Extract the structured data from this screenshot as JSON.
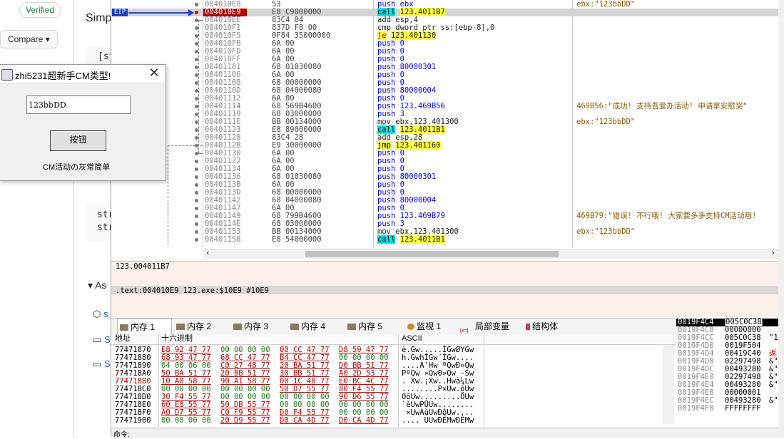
{
  "background_page": {
    "verified_label": "Verified",
    "compare_label": "Compare ▾",
    "heading_fragment": "Simp",
    "code_fragment_1": "[st",
    "code_fragment_2": "str",
    "code_fragment_3": "str",
    "section_fragment": "As",
    "link_fragment_1": "s",
    "link_fragment_2": "S",
    "link_fragment_3": "S"
  },
  "dialog": {
    "title": "zhi5231超新手CM类型!",
    "input_value": "123bbDD",
    "button_label": "按钮",
    "message": "CM活动の灰常简单"
  },
  "disasm": {
    "eip_label": "EIP",
    "rows": [
      {
        "addr": "004010E8",
        "bytes": "53",
        "ins": "push ebx",
        "kind": "push",
        "cmt": "ebx:\"123bbDD\""
      },
      {
        "addr": "004010E9",
        "bytes": "E8 C9000000",
        "ins": "call",
        "target": "123.4011B7",
        "kind": "call",
        "cmt": "",
        "current": true
      },
      {
        "addr": "004010EE",
        "bytes": "83C4 04",
        "ins": "add esp,4",
        "kind": "plain",
        "cmt": ""
      },
      {
        "addr": "004010F1",
        "bytes": "837D F8 00",
        "ins": "cmp dword ptr ss:[ebp-8],0",
        "kind": "plain",
        "cmt": ""
      },
      {
        "addr": "004010F5",
        "bytes": "0F84 35000000",
        "ins": "je",
        "target": "123.401130",
        "kind": "je",
        "cmt": ""
      },
      {
        "addr": "004010FB",
        "bytes": "6A 00",
        "ins": "push 0",
        "kind": "push",
        "cmt": ""
      },
      {
        "addr": "004010FD",
        "bytes": "6A 00",
        "ins": "push 0",
        "kind": "push",
        "cmt": ""
      },
      {
        "addr": "004010FF",
        "bytes": "6A 00",
        "ins": "push 0",
        "kind": "push",
        "cmt": ""
      },
      {
        "addr": "00401101",
        "bytes": "68 01030080",
        "ins": "push 80000301",
        "kind": "push",
        "cmt": ""
      },
      {
        "addr": "00401106",
        "bytes": "6A 00",
        "ins": "push 0",
        "kind": "push",
        "cmt": ""
      },
      {
        "addr": "00401108",
        "bytes": "68 00000000",
        "ins": "push 0",
        "kind": "push",
        "cmt": ""
      },
      {
        "addr": "0040110D",
        "bytes": "68 04000080",
        "ins": "push 80000004",
        "kind": "push",
        "cmt": ""
      },
      {
        "addr": "00401112",
        "bytes": "6A 00",
        "ins": "push 0",
        "kind": "push",
        "cmt": ""
      },
      {
        "addr": "00401114",
        "bytes": "68 569B4600",
        "ins": "push 123.469B56",
        "kind": "push",
        "cmt": "469B56:\"成功! 支持吾爱办活动! 申请拿安慰奖\""
      },
      {
        "addr": "00401119",
        "bytes": "68 03000000",
        "ins": "push 3",
        "kind": "push",
        "cmt": ""
      },
      {
        "addr": "0040111E",
        "bytes": "BB 00134000",
        "ins": "mov ebx,123.401300",
        "kind": "plain",
        "cmt": "ebx:\"123bbDD\""
      },
      {
        "addr": "00401123",
        "bytes": "E8 89000000",
        "ins": "call",
        "target": "123.4011B1",
        "kind": "call",
        "cmt": ""
      },
      {
        "addr": "00401128",
        "bytes": "83C4 28",
        "ins": "add esp,28",
        "kind": "plain",
        "cmt": ""
      },
      {
        "addr": "0040112B",
        "bytes": "E9 30000000",
        "ins": "jmp",
        "target": "123.401160",
        "kind": "jmp",
        "cmt": ""
      },
      {
        "addr": "00401130",
        "bytes": "6A 00",
        "ins": "push 0",
        "kind": "push",
        "cmt": ""
      },
      {
        "addr": "00401132",
        "bytes": "6A 00",
        "ins": "push 0",
        "kind": "push",
        "cmt": ""
      },
      {
        "addr": "00401134",
        "bytes": "6A 00",
        "ins": "push 0",
        "kind": "push",
        "cmt": ""
      },
      {
        "addr": "00401136",
        "bytes": "68 01030080",
        "ins": "push 80000301",
        "kind": "push",
        "cmt": ""
      },
      {
        "addr": "0040113B",
        "bytes": "6A 00",
        "ins": "push 0",
        "kind": "push",
        "cmt": ""
      },
      {
        "addr": "0040113D",
        "bytes": "68 00000000",
        "ins": "push 0",
        "kind": "push",
        "cmt": ""
      },
      {
        "addr": "00401142",
        "bytes": "68 04000080",
        "ins": "push 80000004",
        "kind": "push",
        "cmt": ""
      },
      {
        "addr": "00401147",
        "bytes": "6A 00",
        "ins": "push 0",
        "kind": "push",
        "cmt": ""
      },
      {
        "addr": "00401149",
        "bytes": "68 799B4600",
        "ins": "push 123.469B79",
        "kind": "push",
        "cmt": "469B79:\"错误! 不行哦! 大家要多多支持CM活动哦!"
      },
      {
        "addr": "0040114E",
        "bytes": "68 03000000",
        "ins": "push 3",
        "kind": "push",
        "cmt": ""
      },
      {
        "addr": "00401153",
        "bytes": "BB 00134000",
        "ins": "mov ebx,123.401300",
        "kind": "plain",
        "cmt": "ebx:\"123bbDD\""
      },
      {
        "addr": "00401158",
        "bytes": "E8 54000000",
        "ins": "call",
        "target": "123.4011B1",
        "kind": "call",
        "cmt": ""
      }
    ]
  },
  "info": {
    "line1": "123.004011B7",
    "line2": ".text:004010E9 123.exe:$10E9 #10E9"
  },
  "tabs": [
    {
      "label": "内存 1",
      "active": true
    },
    {
      "label": "内存 2",
      "active": false
    },
    {
      "label": "内存 3",
      "active": false
    },
    {
      "label": "内存 4",
      "active": false
    },
    {
      "label": "内存 5",
      "active": false
    },
    {
      "label": "监视 1",
      "active": false
    },
    {
      "label": "局部变量",
      "active": false
    },
    {
      "label": "结构体",
      "active": false
    }
  ],
  "dump": {
    "col_addr": "地址",
    "col_hex": "十六进制",
    "col_ascii": "ASCII",
    "rows": [
      {
        "addr": "77471870",
        "g1": "E8 92 47 77",
        "g2": "00 00 00 00",
        "g3": "00 CC 47 77",
        "g4": "D8 59 47 77",
        "ascii": "è.Gw.....ÌGwØYGw"
      },
      {
        "addr": "77471880",
        "g1": "68 93 47 77",
        "g2": "68 CC 47 77",
        "g3": "B4 CC 47 77",
        "g4": "00 00 00 00",
        "ascii": "h.GwhÌGw´ÌGw...."
      },
      {
        "addr": "77471890",
        "g1": "04 00 06 00",
        "g2": "C0 27 48 77",
        "g3": "20 BA 51 77",
        "g4": "D0 BB 51 77",
        "ascii": "....À'Hw ºQwÐ»Qw"
      },
      {
        "addr": "774718A0",
        "g1": "50 BA 51 77",
        "g2": "20 BB 51 77",
        "g3": "30 BB 51 77",
        "g4": "A0 2D 53 77",
        "ascii": "PºQw »Qw0»Qw -Sw"
      },
      {
        "addr": "774718B0",
        "g1": "10 A0 58 77",
        "g2": "90 A1 58 77",
        "g3": "00 1C 48 77",
        "g4": "E0 BC 4C 77",
        "ascii": ". Xw.¡Xw..Hwà¼Lw"
      },
      {
        "addr": "774718C0",
        "g1": "00 00 00 00",
        "g2": "00 00 00 00",
        "g3": "50 D7 55 77",
        "g4": "80 F4 55 77",
        "ascii": "........P×Uw.ôUw"
      },
      {
        "addr": "774718D0",
        "g1": "30 F4 55 77",
        "g2": "00 00 00 00",
        "g3": "00 00 00 00",
        "g4": "90 D6 55 77",
        "ascii": "0ôUw.........ÖUw"
      },
      {
        "addr": "774718E0",
        "g1": "60 E8 55 77",
        "g2": "50 DB 55 77",
        "g3": "00 00 00 00",
        "g4": "00 00 00 00",
        "ascii": "`èUwPÛUw........"
      },
      {
        "addr": "774718F0",
        "g1": "A0 D7 55 77",
        "g2": "C0 F9 55 77",
        "g3": "D0 F4 55 77",
        "g4": "00 00 00 00",
        "ascii": " ×UwÀùUwÐôUw...."
      },
      {
        "addr": "77471900",
        "g1": "00 00 00 00",
        "g2": "20 D9 55 77",
        "g3": "D0 CA 4D 77",
        "g4": "D0 CA 4D 77",
        "ascii": ".... ÙUwÐÊMwÐÊMw"
      }
    ]
  },
  "stack": {
    "rows": [
      {
        "addr": "0019F4C4",
        "val": "005C0C38",
        "cmt": "\"1"
      },
      {
        "addr": "0019F4C8",
        "val": "00000000",
        "cmt": ""
      },
      {
        "addr": "0019F4CC",
        "val": "005C0C38",
        "cmt": "\"1"
      },
      {
        "addr": "0019F4D0",
        "val": "0019F504",
        "cmt": ""
      },
      {
        "addr": "0019F4D4",
        "val": "00419C40",
        "cmt": "返"
      },
      {
        "addr": "0019F4D8",
        "val": "02297498",
        "cmt": "&\""
      },
      {
        "addr": "0019F4DC",
        "val": "00493280",
        "cmt": "&\""
      },
      {
        "addr": "0019F4E0",
        "val": "02297498",
        "cmt": "&\""
      },
      {
        "addr": "0019F4E4",
        "val": "00493280",
        "cmt": "&\""
      },
      {
        "addr": "0019F4E8",
        "val": "00000001",
        "cmt": ""
      },
      {
        "addr": "0019F4EC",
        "val": "00493280",
        "cmt": "&\""
      },
      {
        "addr": "0019F4F0",
        "val": "FFFFFFFF",
        "cmt": ""
      }
    ]
  },
  "cmd_label": "命令:"
}
